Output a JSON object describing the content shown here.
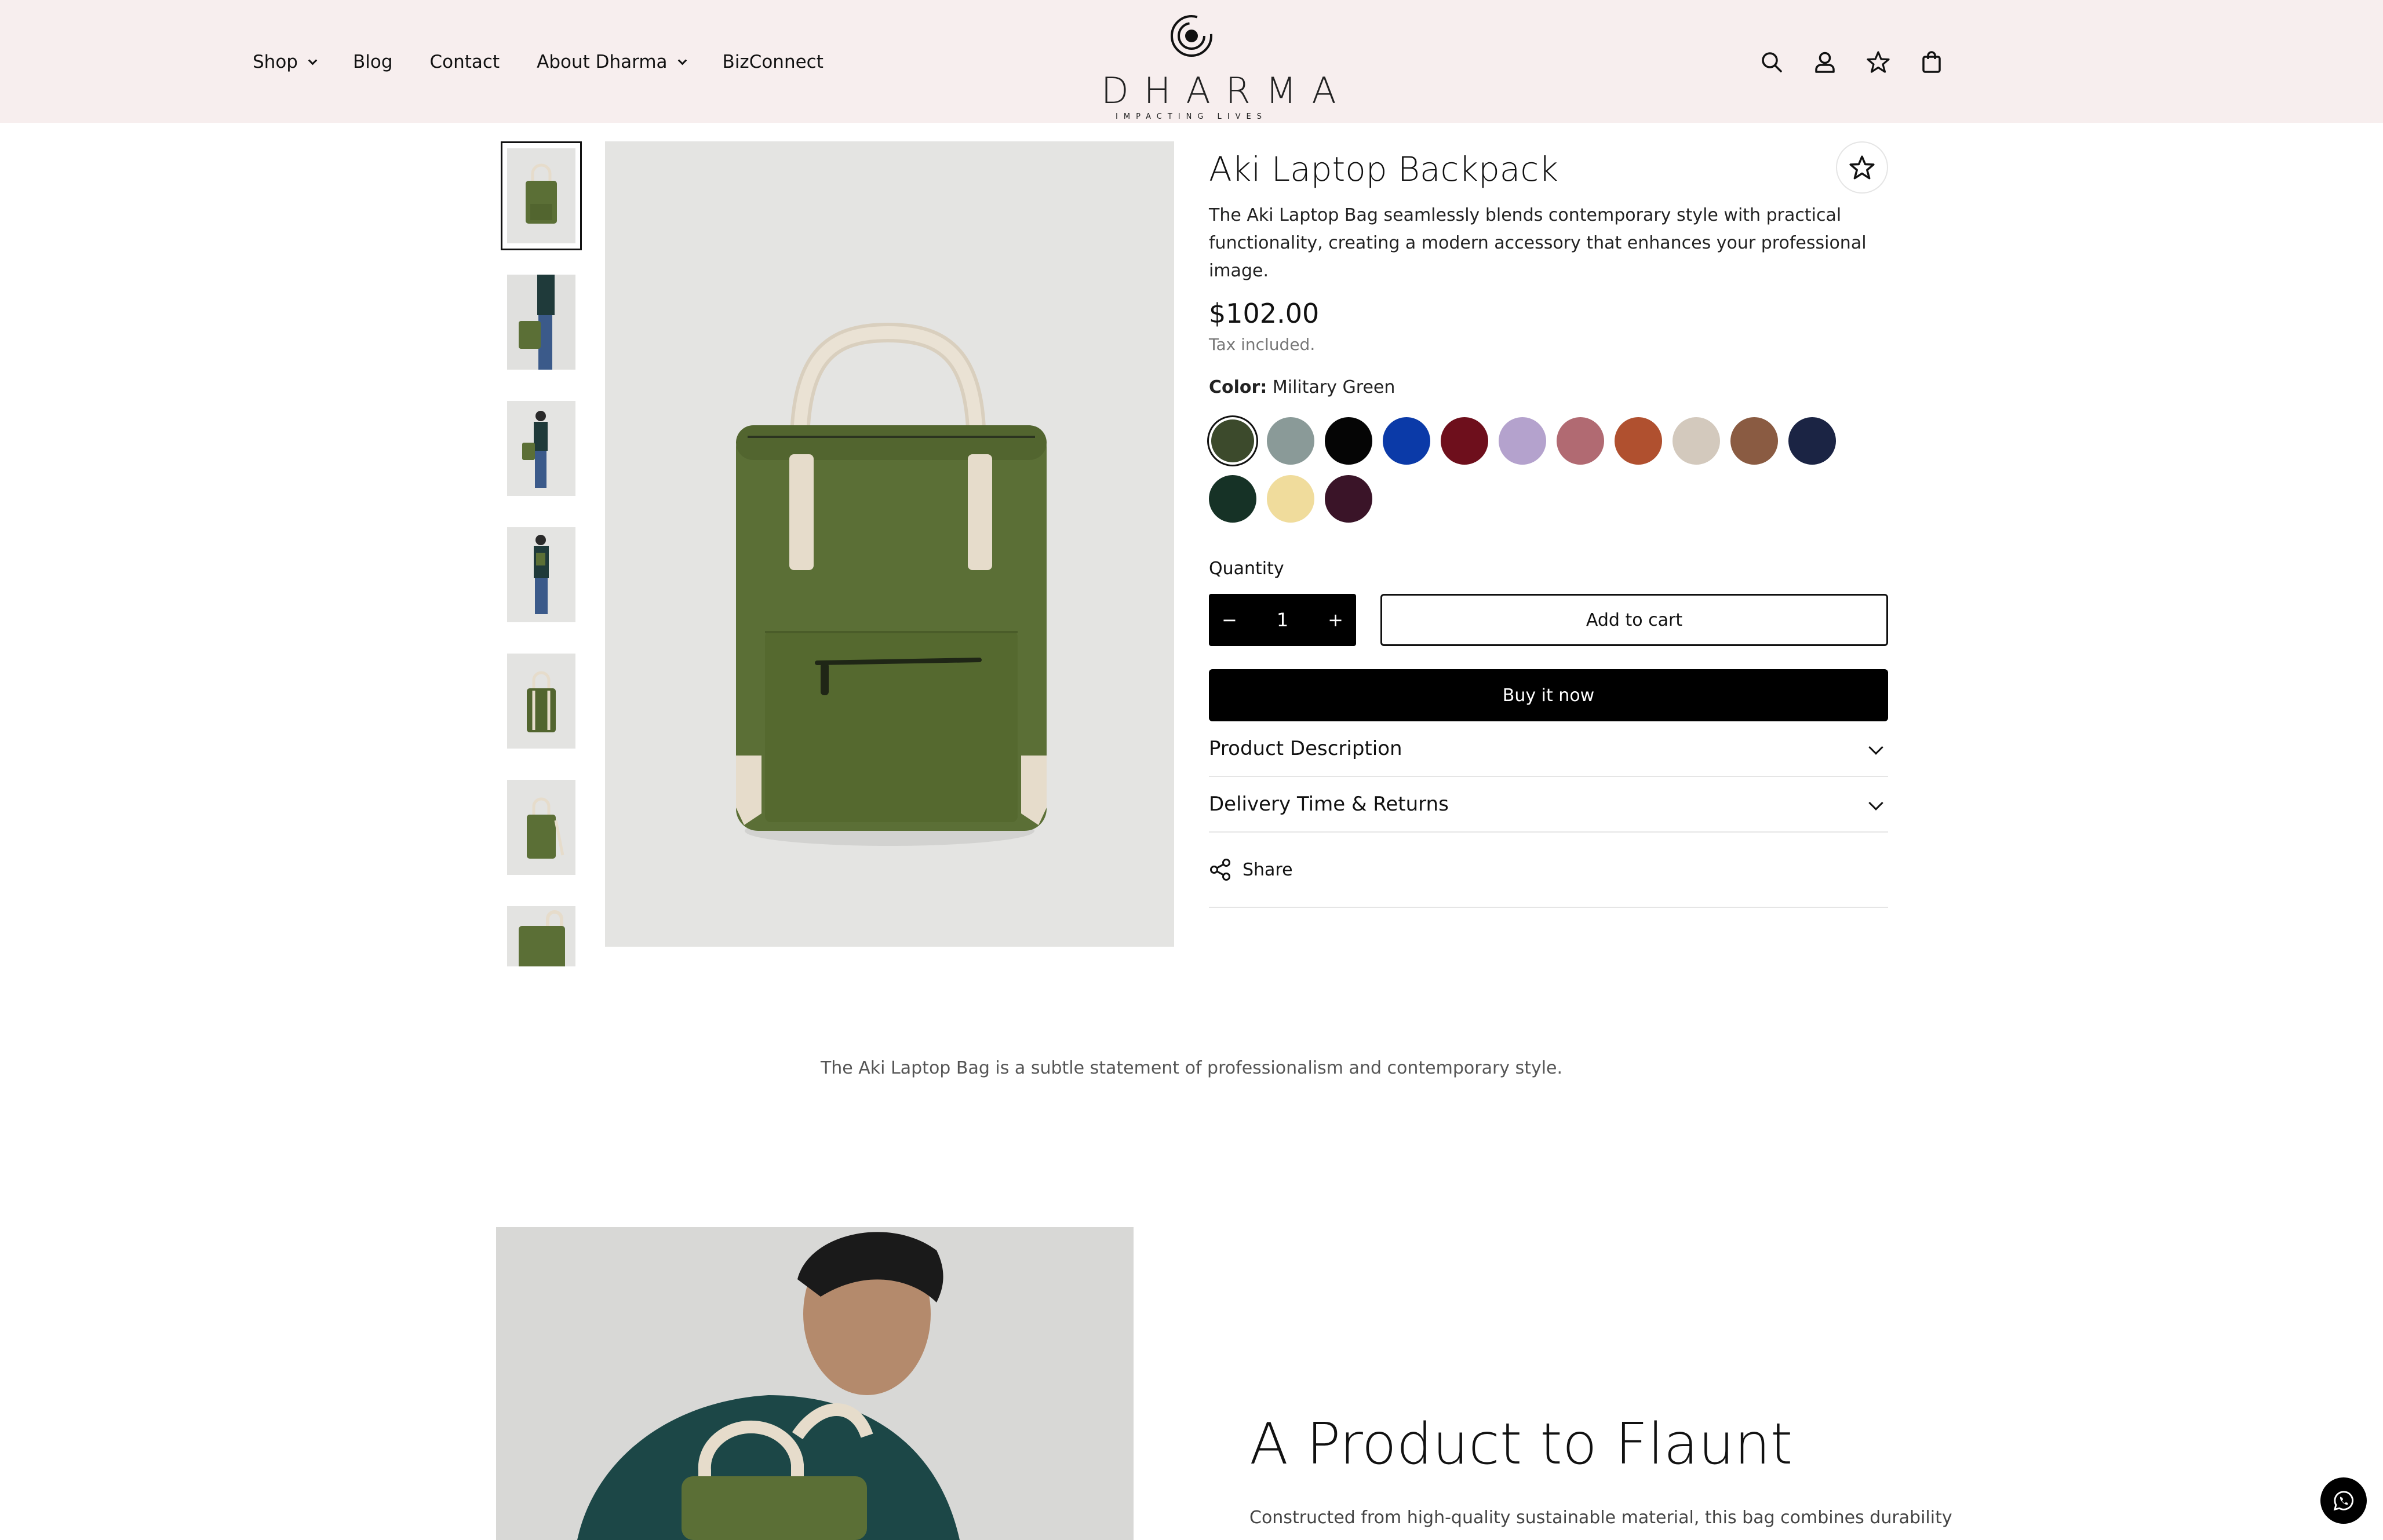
{
  "nav": {
    "items": [
      {
        "label": "Shop",
        "dropdown": true
      },
      {
        "label": "Blog",
        "dropdown": false
      },
      {
        "label": "Contact",
        "dropdown": false
      },
      {
        "label": "About Dharma",
        "dropdown": true
      },
      {
        "label": "BizConnect",
        "dropdown": false
      }
    ]
  },
  "logo": {
    "word": "DHARMA",
    "sub": "IMPACTING LIVES"
  },
  "header_icons": [
    "search-icon",
    "account-icon",
    "wishlist-star-icon",
    "cart-bag-icon"
  ],
  "product": {
    "title": "Aki Laptop Backpack",
    "description": "The Aki Laptop Bag seamlessly blends contemporary style with practical functionality, creating a modern accessory that enhances your professional image.",
    "price": "$102.00",
    "tax_note": "Tax included.",
    "color_label": "Color:",
    "color_value": "Military Green",
    "swatches": [
      "#3c4a2c",
      "#8a9a98",
      "#050505",
      "#0b3aa8",
      "#6e0f1c",
      "#b4a2cd",
      "#b16a72",
      "#b0502f",
      "#d3c9bd",
      "#8a5b42",
      "#1b2444",
      "#163226",
      "#f0dc9c",
      "#3a1428"
    ],
    "quantity_label": "Quantity",
    "quantity_value": "1",
    "minus": "−",
    "plus": "+",
    "add_to_cart": "Add to cart",
    "buy_now": "Buy it now",
    "accordions": [
      "Product Description",
      "Delivery Time & Returns"
    ],
    "share": "Share"
  },
  "thumbnails": 7,
  "tagline": "The Aki Laptop Bag is a subtle statement of professionalism and contemporary style.",
  "feature": {
    "heading": "A Product to Flaunt",
    "text": "Constructed from high-quality sustainable material, this bag combines durability"
  },
  "colors": {
    "header_bg": "#f7eeee",
    "bag_green": "#5b6f36",
    "handle": "#e6dccb"
  }
}
